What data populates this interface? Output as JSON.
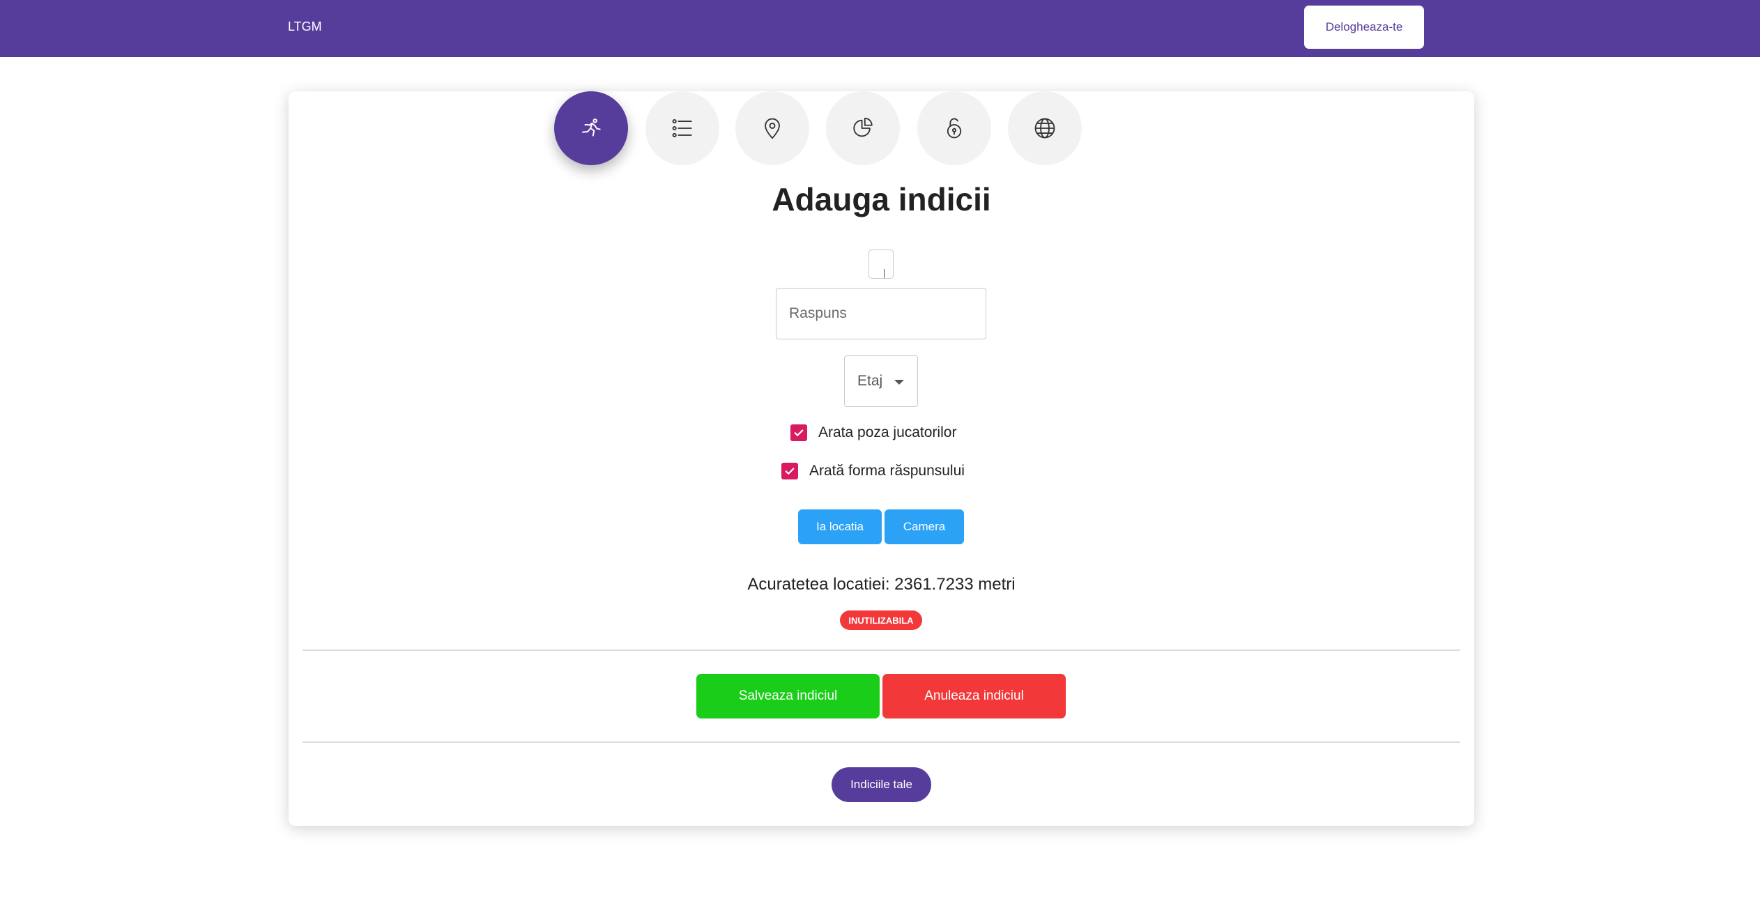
{
  "header": {
    "brand": "LTGM",
    "logout_label": "Delogheaza-te"
  },
  "tabs": [
    {
      "icon": "running-person-icon",
      "active": true
    },
    {
      "icon": "list-icon",
      "active": false
    },
    {
      "icon": "map-pin-icon",
      "active": false
    },
    {
      "icon": "pie-chart-icon",
      "active": false
    },
    {
      "icon": "unlock-icon",
      "active": false
    },
    {
      "icon": "globe-icon",
      "active": false
    }
  ],
  "form": {
    "title": "Adauga indicii",
    "answer_placeholder": "Raspuns",
    "answer_value": "",
    "floor_select_label": "Etaj",
    "checkbox_show_photo": {
      "label": "Arata poza jucatorilor",
      "checked": true
    },
    "checkbox_show_answer_form": {
      "label": "Arată forma răspunsului",
      "checked": true
    },
    "take_location_label": "Ia locatia",
    "camera_label": "Camera",
    "accuracy_text": "Acuratetea locatiei: 2361.7233 metri",
    "accuracy_badge": "INUTILIZABILA"
  },
  "actions": {
    "save_label": "Salveaza indiciul",
    "cancel_label": "Anuleaza indiciul",
    "my_clues_label": "Indiciile tale"
  },
  "colors": {
    "primary": "#563d9c",
    "save": "#19cd19",
    "danger": "#f23838",
    "info": "#2ba2f5",
    "checkbox": "#d81b60"
  }
}
